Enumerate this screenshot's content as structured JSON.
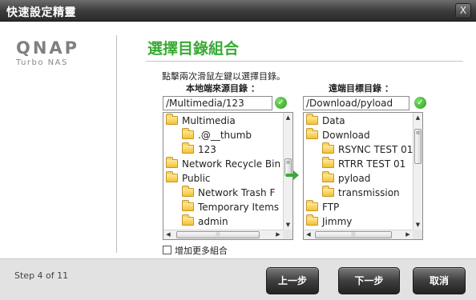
{
  "window": {
    "title": "快速設定精靈",
    "close_glyph": "X"
  },
  "logo": {
    "brand": "QNAP",
    "sub": "Turbo NAS"
  },
  "heading": "選擇目錄組合",
  "instruction": "點擊兩次滑鼠左鍵以選擇目錄。",
  "local": {
    "label": "本地端來源目錄 ：",
    "path": "/Multimedia/123",
    "tree": [
      {
        "label": "Multimedia",
        "level": 0
      },
      {
        "label": ".@__thumb",
        "level": 1
      },
      {
        "label": "123",
        "level": 1
      },
      {
        "label": "Network Recycle Bin",
        "level": 0
      },
      {
        "label": "Public",
        "level": 0
      },
      {
        "label": "Network Trash F",
        "level": 1
      },
      {
        "label": "Temporary Items",
        "level": 1
      },
      {
        "label": "admin",
        "level": 1
      }
    ],
    "vscroll_fraction": 0.45
  },
  "remote": {
    "label": "遠端目標目錄 ：",
    "path": "/Download/pyload",
    "tree": [
      {
        "label": "Data",
        "level": 0
      },
      {
        "label": "Download",
        "level": 0
      },
      {
        "label": "RSYNC TEST 01",
        "level": 1
      },
      {
        "label": "RTRR TEST 01",
        "level": 1
      },
      {
        "label": "pyload",
        "level": 1
      },
      {
        "label": "transmission",
        "level": 1
      },
      {
        "label": "FTP",
        "level": 0
      },
      {
        "label": "Jimmy",
        "level": 0
      }
    ],
    "vscroll_fraction": 0.1
  },
  "add_more_label": "增加更多組合",
  "footer": {
    "step": "Step 4 of 11",
    "back_label": "上一步",
    "next_label": "下一步",
    "cancel_label": "取消"
  },
  "colors": {
    "heading": "#3aaa35",
    "arrow": "#3aaa35",
    "titlebar": "#3a3a3a"
  },
  "icons": {
    "check": "check-circle-icon",
    "arrow": "arrow-right-icon",
    "folder": "folder-icon"
  }
}
